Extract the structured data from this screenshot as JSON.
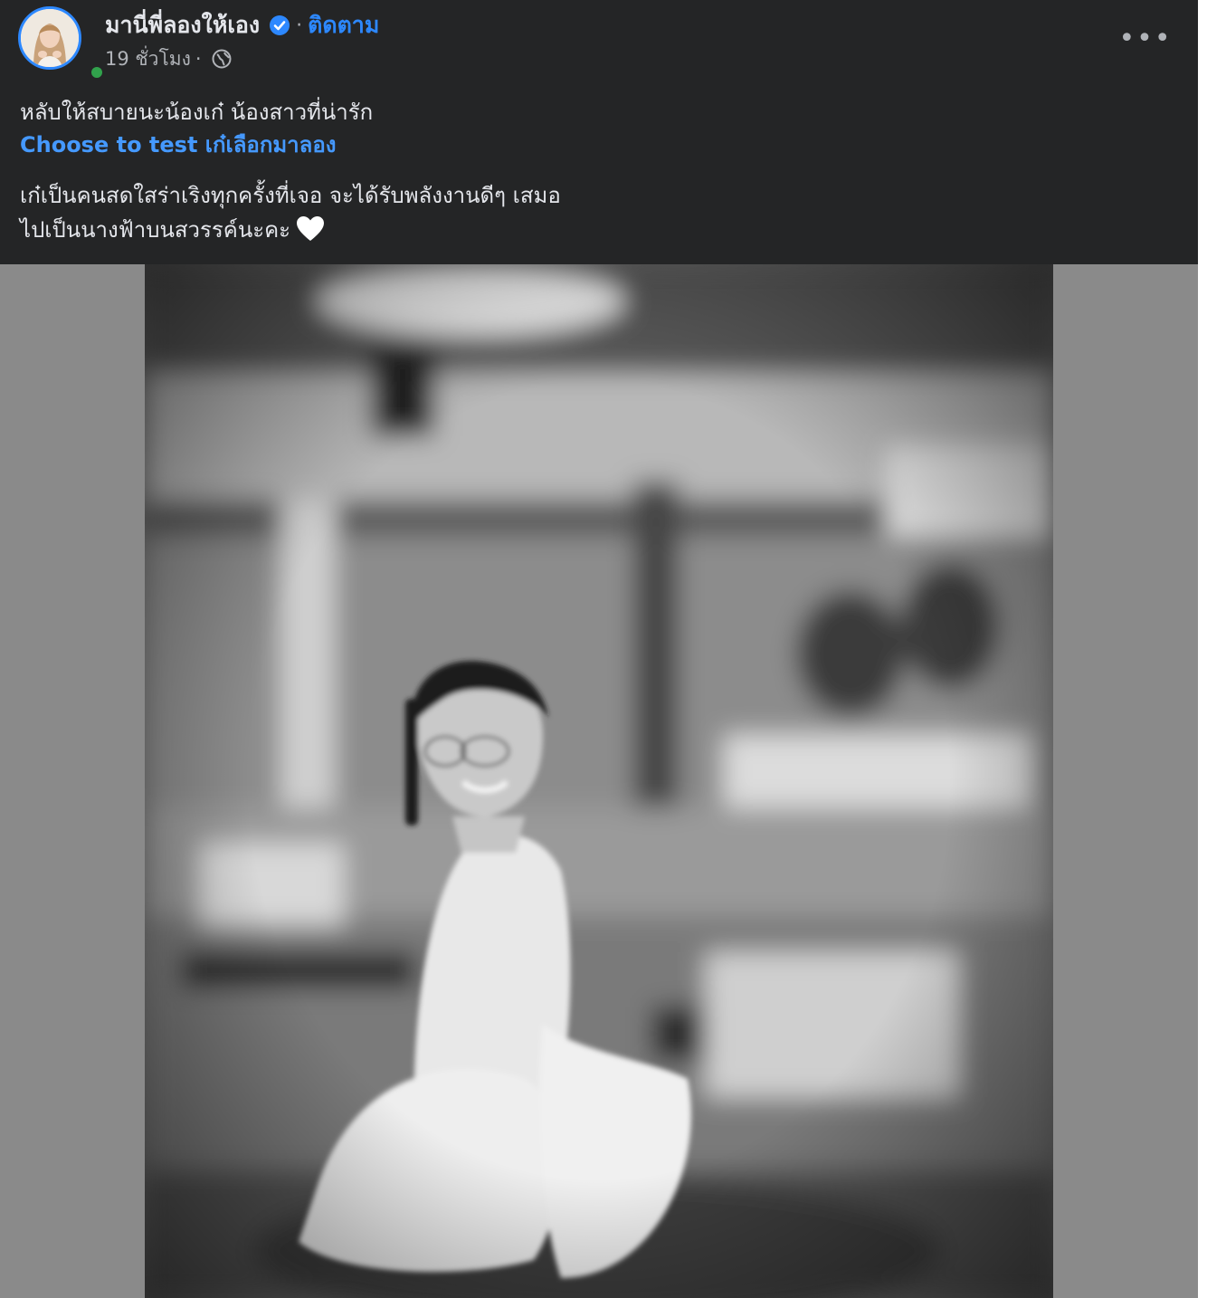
{
  "post": {
    "page_name": "มานี่พี่ลองให้เอง",
    "separator": "·",
    "follow_label": "ติดตาม",
    "time": "19 ชั่วโมง",
    "time_separator": "·",
    "more_label": "•••",
    "caption_line1": "หลับให้สบายนะน้องเก๋ น้องสาวที่น่ารัก",
    "caption_link": "Choose to test เก๋เลือกมาลอง",
    "caption_line2": "เก๋เป็นคนสดใสร่าเริงทุกครั้งที่เจอ จะได้รับพลังงานดีๆ เสมอ",
    "caption_line3": "ไปเป็นนางฟ้าบนสวรรค์นะคะ"
  },
  "icons": {
    "verified": "verified-badge-icon",
    "globe": "globe-icon",
    "heart": "white-heart-icon",
    "more": "more-options-icon"
  },
  "colors": {
    "background": "#242526",
    "text": "#e4e6eb",
    "secondary_text": "#b0b3b8",
    "accent": "#2d88ff",
    "online": "#31a24c"
  }
}
